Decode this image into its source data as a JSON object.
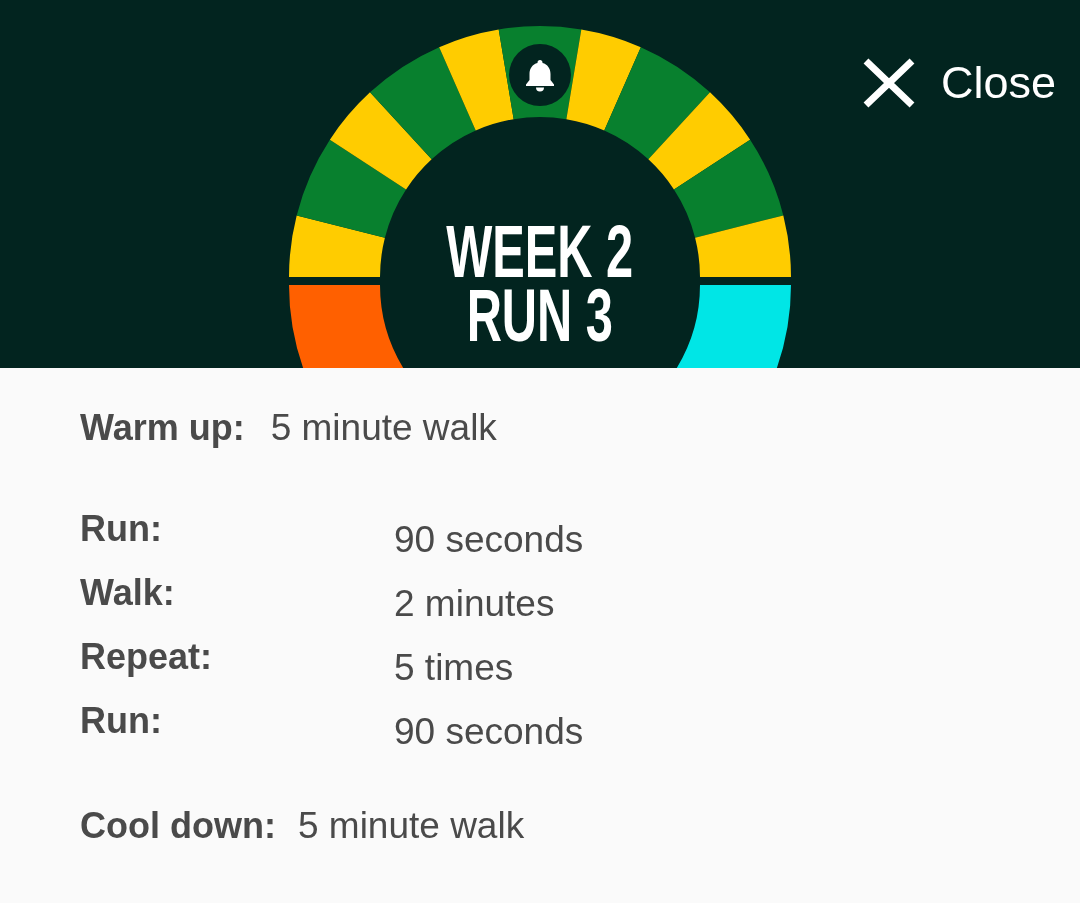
{
  "header": {
    "ring": {
      "segments": [
        {
          "kind": "warmup",
          "color": "#ff6000"
        },
        {
          "kind": "run",
          "color": "#ffcc00"
        },
        {
          "kind": "walk",
          "color": "#08802e"
        },
        {
          "kind": "run",
          "color": "#ffcc00"
        },
        {
          "kind": "walk",
          "color": "#08802e"
        },
        {
          "kind": "run",
          "color": "#ffcc00"
        },
        {
          "kind": "walk",
          "color": "#08802e"
        },
        {
          "kind": "run",
          "color": "#ffcc00"
        },
        {
          "kind": "walk",
          "color": "#08802e"
        },
        {
          "kind": "run",
          "color": "#ffcc00"
        },
        {
          "kind": "walk",
          "color": "#08802e"
        },
        {
          "kind": "run",
          "color": "#ffcc00"
        },
        {
          "kind": "cooldown",
          "color": "#00e6e6"
        }
      ]
    },
    "title": [
      "WEEK 2",
      "RUN 3"
    ],
    "close_button": {
      "label": "Close"
    }
  },
  "plan": {
    "warm_up": {
      "label": "Warm up:",
      "value": "5 minute walk"
    },
    "steps": [
      {
        "label": "Run:",
        "value": "90 seconds"
      },
      {
        "label": "Walk:",
        "value": "2 minutes"
      },
      {
        "label": "Repeat:",
        "value": "5 times"
      },
      {
        "label": "Run:",
        "value": "90 seconds"
      }
    ],
    "cool_down": {
      "label": "Cool down:",
      "value": "5 minute walk"
    }
  }
}
